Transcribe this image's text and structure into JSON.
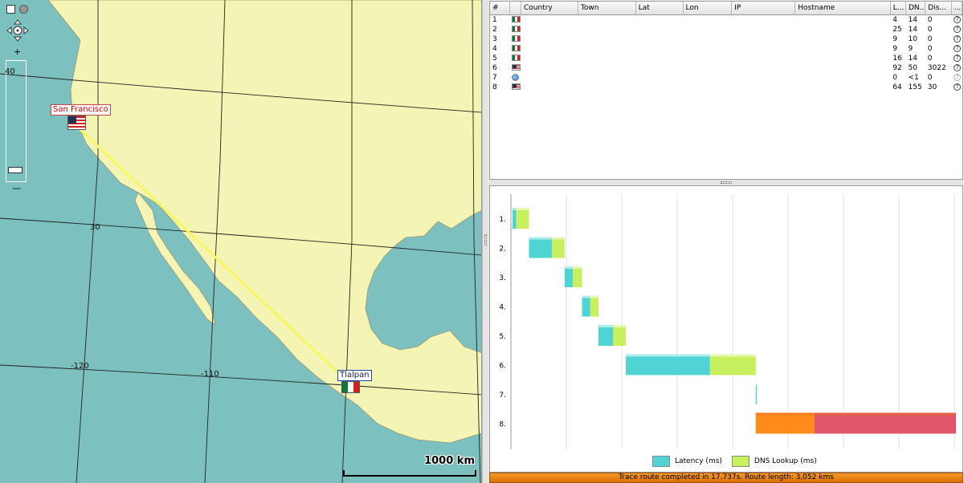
{
  "map": {
    "labels": {
      "lat_40": "40",
      "lat_30": "30",
      "lon_m120": "-120",
      "lon_m110": "-110"
    },
    "cities": [
      {
        "name": "San Francisco",
        "country": "us"
      },
      {
        "name": "Tlalpan",
        "country": "mx"
      }
    ],
    "zoom_plus": "+",
    "zoom_minus": "—",
    "scale_label": "1000 km",
    "colors": {
      "land": "#f4f4b4",
      "water": "#7cc0bf",
      "route": "#f7f763"
    }
  },
  "table": {
    "columns": [
      "#",
      "",
      "Country",
      "Town",
      "Lat",
      "Lon",
      "IP",
      "Hostname",
      "L...",
      "DN...",
      "Dis...",
      "..."
    ],
    "rows": [
      {
        "n": "1",
        "flag": "mx",
        "country": "",
        "town": "",
        "lat": "",
        "lon": "",
        "ip": "",
        "hostname": "",
        "latency": "4",
        "dns": "14",
        "dist": "0",
        "help": "?"
      },
      {
        "n": "2",
        "flag": "mx",
        "country": "",
        "town": "",
        "lat": "",
        "lon": "",
        "ip": "",
        "hostname": "",
        "latency": "25",
        "dns": "14",
        "dist": "0",
        "help": "?"
      },
      {
        "n": "3",
        "flag": "mx",
        "country": "",
        "town": "",
        "lat": "",
        "lon": "",
        "ip": "",
        "hostname": "",
        "latency": "9",
        "dns": "10",
        "dist": "0",
        "help": "?"
      },
      {
        "n": "4",
        "flag": "mx",
        "country": "",
        "town": "",
        "lat": "",
        "lon": "",
        "ip": "",
        "hostname": "",
        "latency": "9",
        "dns": "9",
        "dist": "0",
        "help": "?"
      },
      {
        "n": "5",
        "flag": "mx",
        "country": "",
        "town": "",
        "lat": "",
        "lon": "",
        "ip": "",
        "hostname": "",
        "latency": "16",
        "dns": "14",
        "dist": "0",
        "help": "?"
      },
      {
        "n": "6",
        "flag": "us",
        "country": "",
        "town": "",
        "lat": "",
        "lon": "",
        "ip": "",
        "hostname": "",
        "latency": "92",
        "dns": "50",
        "dist": "3022",
        "help": "?"
      },
      {
        "n": "7",
        "flag": "globe",
        "country": "",
        "town": "",
        "lat": "",
        "lon": "",
        "ip": "",
        "hostname": "",
        "latency": "0",
        "dns": "<1",
        "dist": "0",
        "help": "?"
      },
      {
        "n": "8",
        "flag": "us",
        "country": "",
        "town": "",
        "lat": "",
        "lon": "",
        "ip": "",
        "hostname": "",
        "latency": "64",
        "dns": "155",
        "dist": "30",
        "help": "?"
      }
    ]
  },
  "chart_data": {
    "type": "bar",
    "orientation": "horizontal-waterfall",
    "categories": [
      "1.",
      "2.",
      "3.",
      "4.",
      "5.",
      "6.",
      "7.",
      "8."
    ],
    "series": [
      {
        "name": "Latency (ms)",
        "values": [
          4,
          25,
          9,
          9,
          16,
          92,
          0,
          64
        ],
        "color": "#4fd3d3"
      },
      {
        "name": "DNS Lookup (ms)",
        "values": [
          14,
          14,
          10,
          9,
          14,
          50,
          0,
          155
        ],
        "color": "#c7ef5e"
      }
    ],
    "timeout_colors": {
      "latency": "#ff8c1a",
      "dns": "#e0566a"
    },
    "grid": true,
    "legend_position": "bottom-center"
  },
  "status": {
    "text": "Trace route completed in 17.737s. Route length: 3,052 kms",
    "color": "#f28a1a"
  }
}
